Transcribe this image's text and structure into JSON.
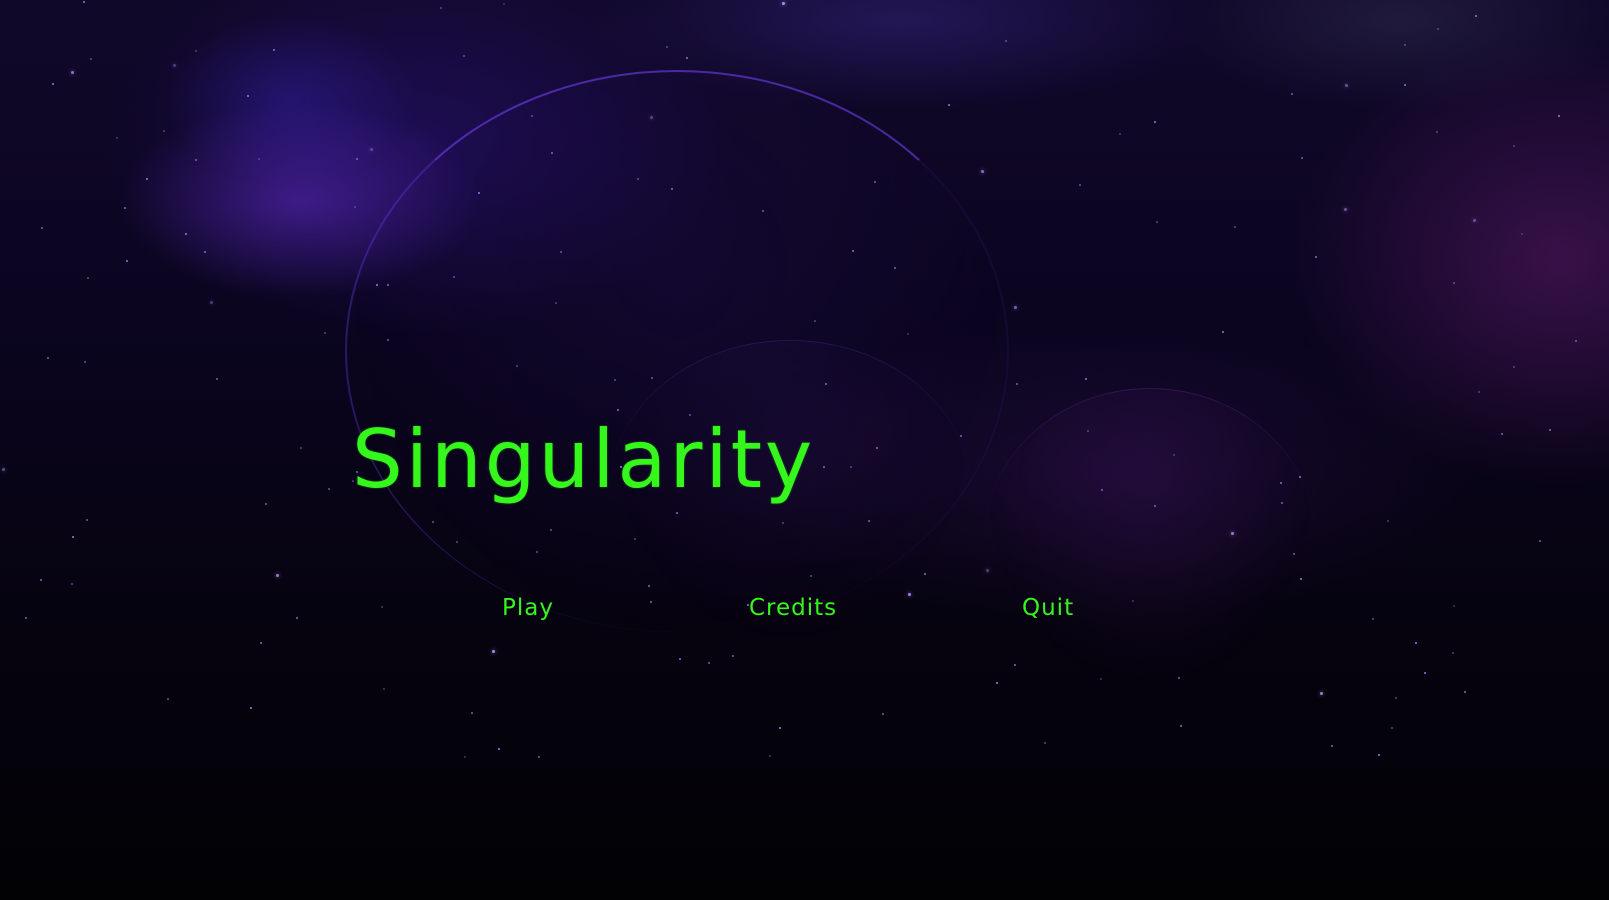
{
  "title": "Singularity",
  "menu": {
    "play_label": "Play",
    "credits_label": "Credits",
    "quit_label": "Quit"
  },
  "colors": {
    "text_accent": "#35f71c",
    "background_dark": "#05030c",
    "nebula_purple": "#6e32e6"
  }
}
